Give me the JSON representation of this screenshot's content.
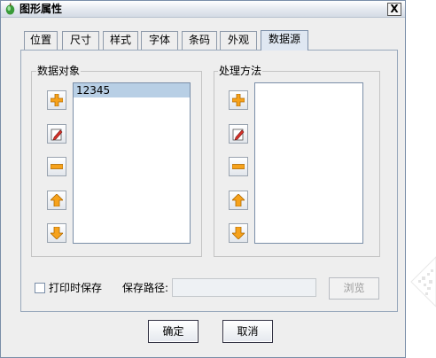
{
  "window": {
    "title": "图形属性",
    "close_label": "X"
  },
  "tabs": [
    {
      "label": "位置"
    },
    {
      "label": "尺寸"
    },
    {
      "label": "样式"
    },
    {
      "label": "字体"
    },
    {
      "label": "条码"
    },
    {
      "label": "外观"
    },
    {
      "label": "数据源",
      "active": true
    }
  ],
  "data_objects": {
    "title": "数据对象",
    "items": [
      "12345"
    ]
  },
  "processing_methods": {
    "title": "处理方法",
    "items": []
  },
  "toolbar_icons": [
    "add-icon",
    "edit-icon",
    "remove-icon",
    "move-up-icon",
    "move-down-icon"
  ],
  "bottom": {
    "print_save_label": "打印时保存",
    "print_save_checked": false,
    "save_path_label": "保存路径:",
    "save_path_value": "",
    "browse_label": "浏览"
  },
  "buttons": {
    "ok_label": "确定",
    "cancel_label": "取消"
  },
  "colors": {
    "selection": "#b8cfe5",
    "panel_bg": "#eeeeee",
    "icon_orange": "#f6a21c"
  }
}
